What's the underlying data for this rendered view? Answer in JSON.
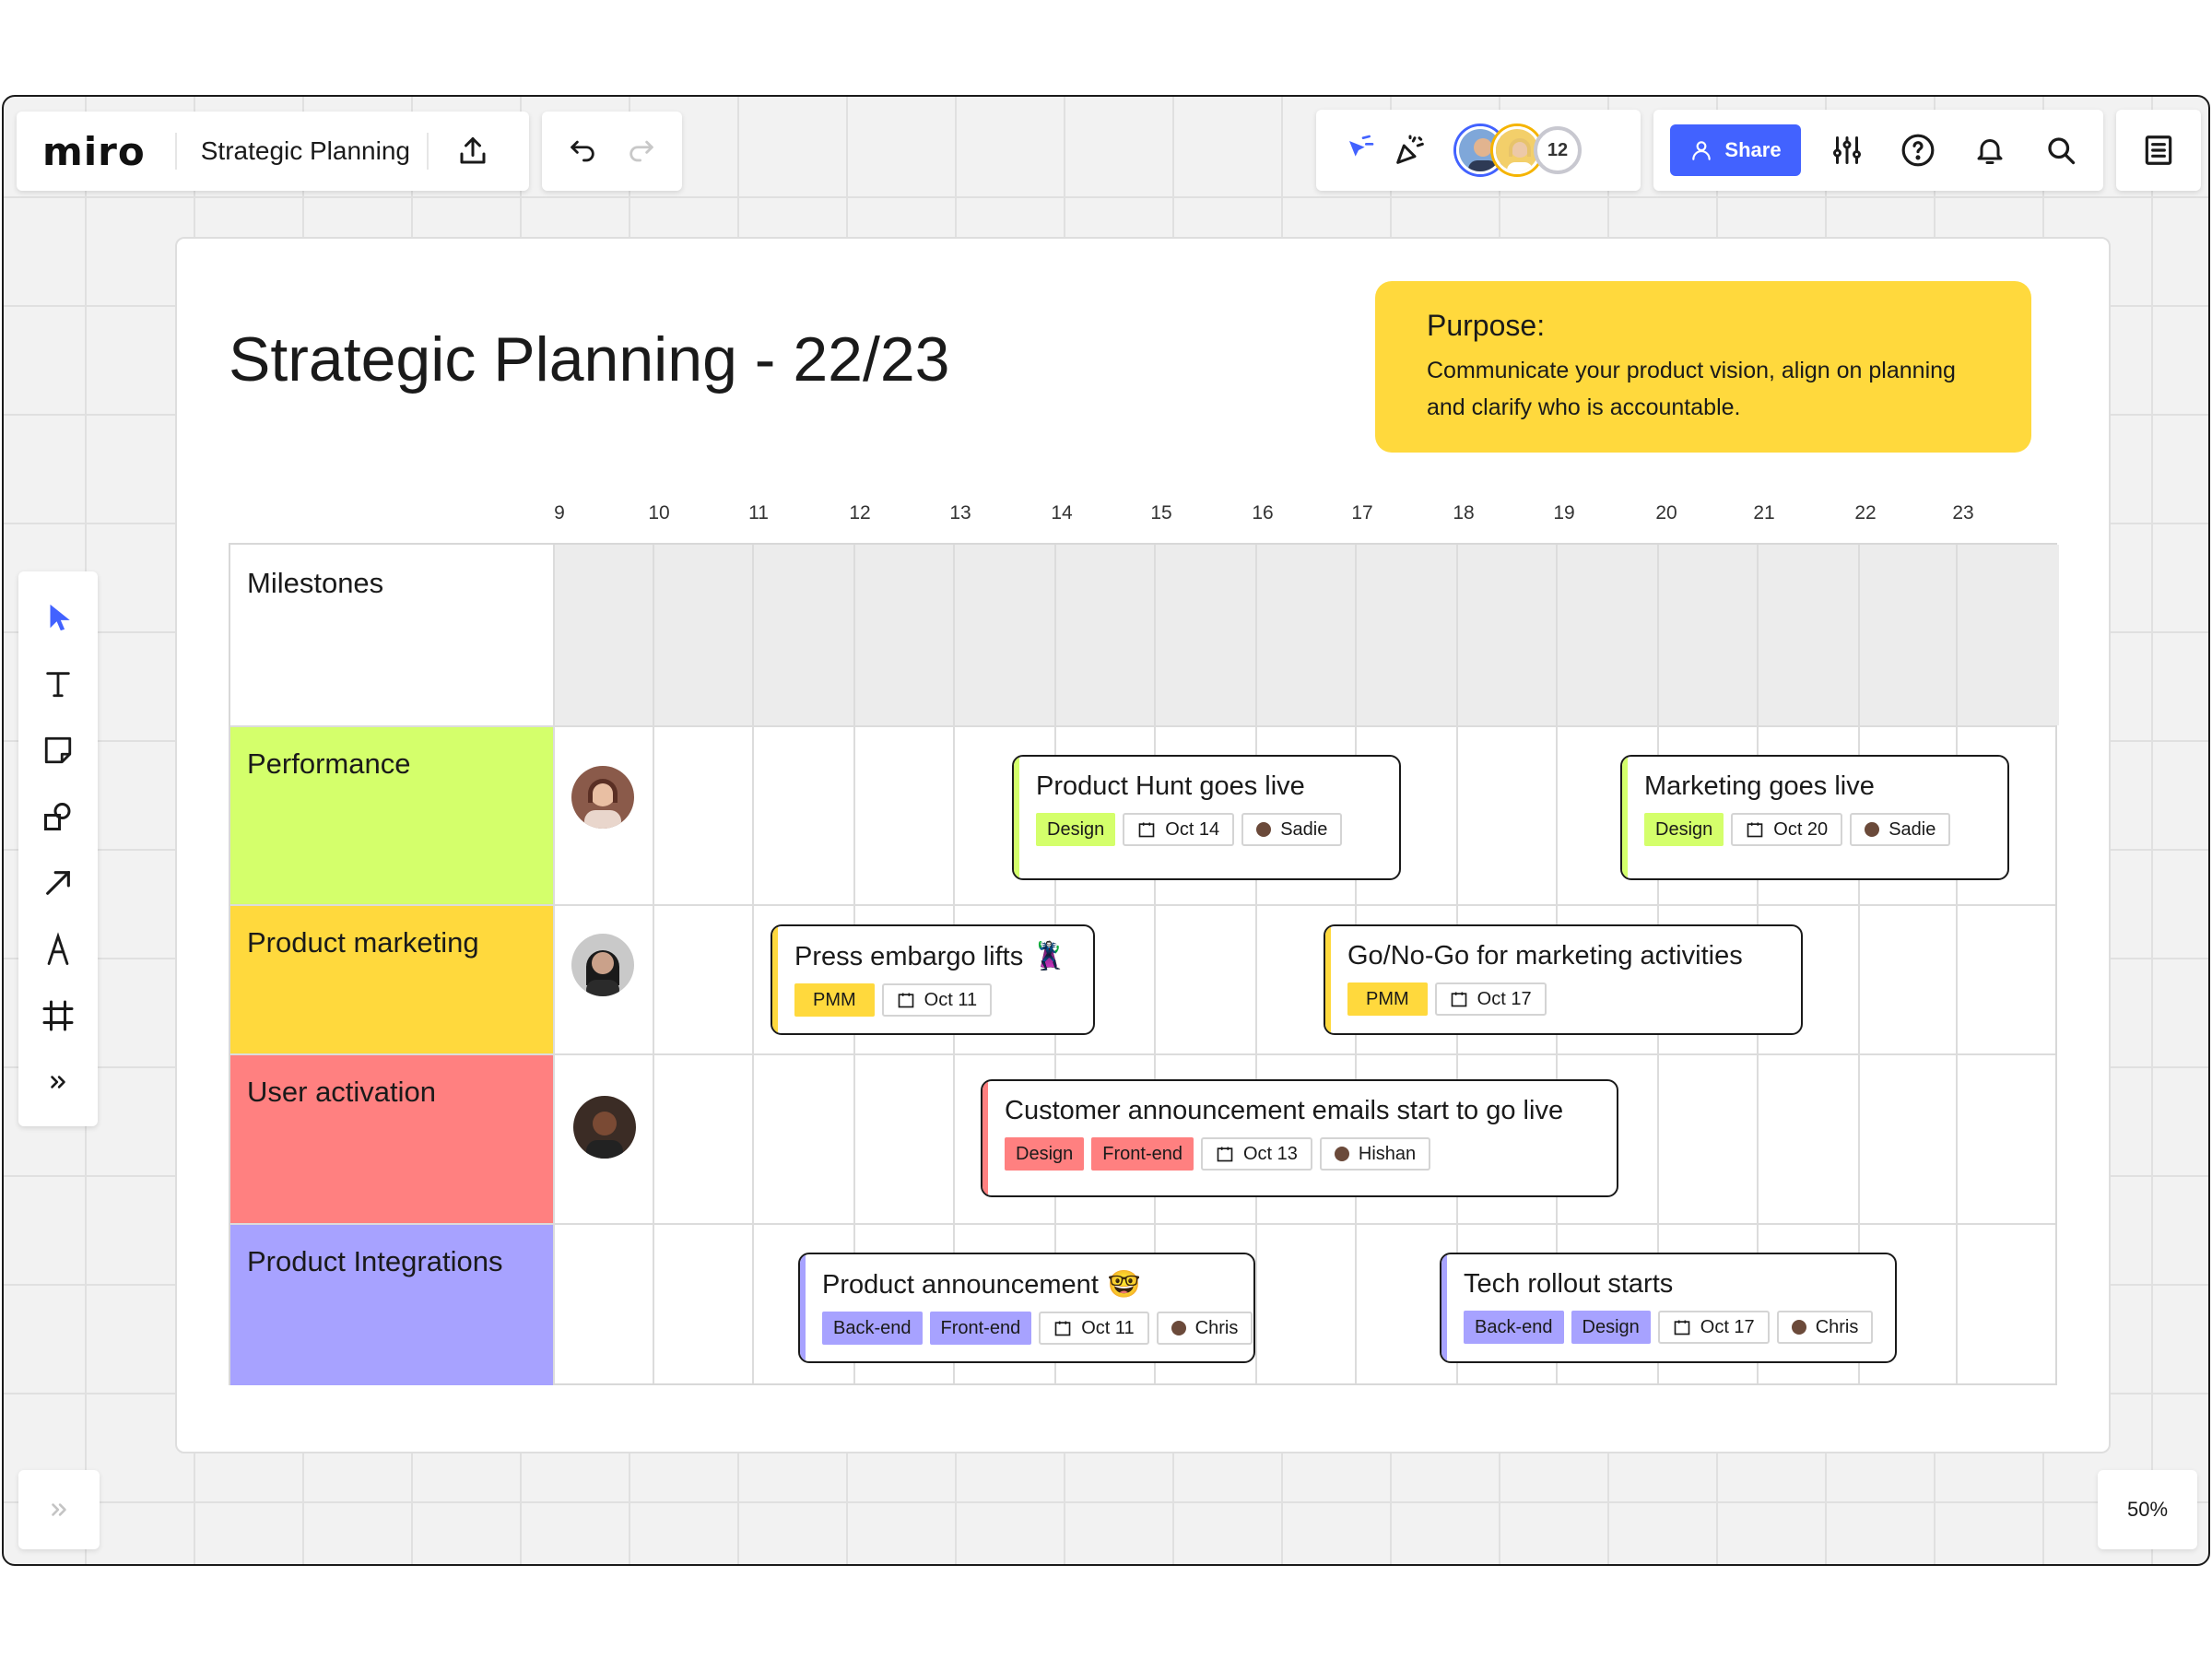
{
  "app": {
    "logo": "miro",
    "board_title": "Strategic Planning",
    "collaborator_count": "12",
    "share_label": "Share",
    "zoom": "50%"
  },
  "colors": {
    "accent": "#4262ff",
    "performance": "#d4ff6b",
    "product_marketing": "#ffd93d",
    "user_activation": "#ff8080",
    "product_integrations": "#a7a2ff",
    "purpose_note": "#ffd93d"
  },
  "toolbar_icons": [
    "upload-icon",
    "undo-icon",
    "redo-icon",
    "select-cursor-icon",
    "celebrate-icon",
    "settings-sliders-icon",
    "help-icon",
    "bell-icon",
    "search-icon",
    "notes-icon"
  ],
  "tools": [
    "select-tool-icon",
    "text-tool-icon",
    "sticky-note-icon",
    "shapes-icon",
    "arrow-icon",
    "pen-icon",
    "frame-icon",
    "more-tools-icon"
  ],
  "board": {
    "heading": "Strategic Planning - 22/23",
    "purpose": {
      "title": "Purpose:",
      "text": "Communicate your product vision, align on planning and clarify who is accountable."
    },
    "days": [
      "9",
      "10",
      "11",
      "12",
      "13",
      "14",
      "15",
      "16",
      "17",
      "18",
      "19",
      "20",
      "21",
      "22",
      "23"
    ],
    "rows": [
      {
        "label": "Milestones"
      },
      {
        "label": "Performance"
      },
      {
        "label": "Product marketing"
      },
      {
        "label": "User activation"
      },
      {
        "label": "Product Integrations"
      }
    ],
    "cards": [
      {
        "title": "Product Hunt goes live",
        "tags": [
          "Design"
        ],
        "date": "Oct 14",
        "owner": "Sadie"
      },
      {
        "title": "Marketing goes live",
        "tags": [
          "Design"
        ],
        "date": "Oct 20",
        "owner": "Sadie"
      },
      {
        "title": "Press embargo lifts",
        "emoji": "🦹",
        "tags": [
          "PMM"
        ],
        "date": "Oct 11"
      },
      {
        "title": "Go/No-Go for marketing activities",
        "tags": [
          "PMM"
        ],
        "date": "Oct 17"
      },
      {
        "title": "Customer announcement emails start to go live",
        "tags": [
          "Design",
          "Front-end"
        ],
        "date": "Oct 13",
        "owner": "Hishan"
      },
      {
        "title": "Product announcement",
        "emoji": "🤓",
        "tags": [
          "Back-end",
          "Front-end"
        ],
        "date": "Oct 11",
        "owner": "Chris"
      },
      {
        "title": "Tech rollout starts",
        "tags": [
          "Back-end",
          "Design"
        ],
        "date": "Oct 17",
        "owner": "Chris"
      }
    ]
  }
}
